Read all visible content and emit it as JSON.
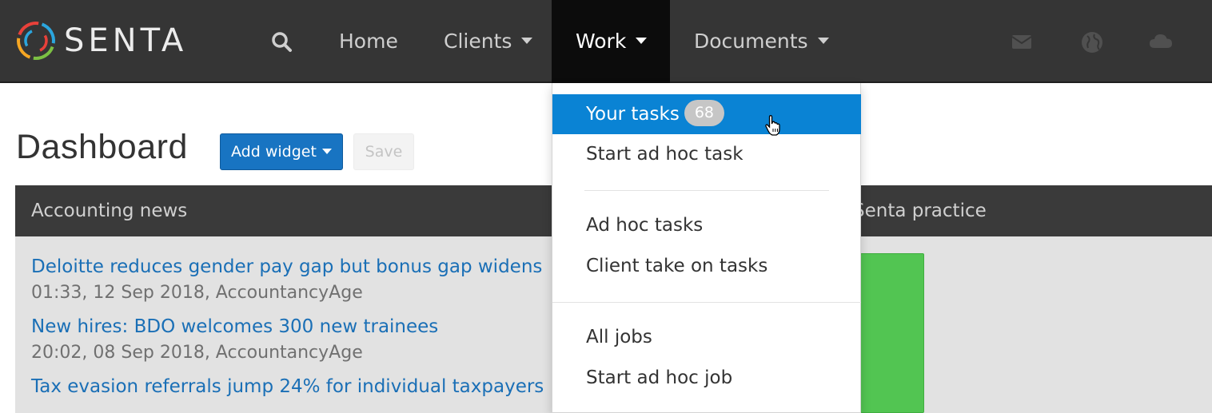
{
  "app": {
    "brand": "SENTA"
  },
  "nav": {
    "home": "Home",
    "clients": "Clients",
    "work": "Work",
    "documents": "Documents"
  },
  "icons": {
    "search": "search-icon",
    "mail": "envelope-icon",
    "globe": "globe-icon",
    "cloud": "cloud-icon"
  },
  "colors": {
    "nav_bg": "#353535",
    "active_nav_bg": "#0c0c0c",
    "accent": "#0a83d4",
    "button_primary": "#1874c2",
    "link": "#1a6fb6",
    "chart_bar": "#52c552"
  },
  "page": {
    "title": "Dashboard",
    "add_widget_label": "Add widget",
    "save_label": "Save"
  },
  "widgets": {
    "news_title": "Accounting news",
    "second_title": "Senta practice",
    "news": [
      {
        "title": "Deloitte reduces gender pay gap but bonus gap widens",
        "meta": "01:33, 12 Sep 2018, AccountancyAge"
      },
      {
        "title": "New hires: BDO welcomes 300 new trainees",
        "meta": "20:02, 08 Sep 2018, AccountancyAge"
      },
      {
        "title": "Tax evasion referrals jump 24% for individual taxpayers",
        "meta": ""
      }
    ]
  },
  "work_menu": {
    "your_tasks": "Your tasks",
    "your_tasks_count": "68",
    "start_ad_hoc_task": "Start ad hoc task",
    "ad_hoc_tasks": "Ad hoc tasks",
    "client_take_on_tasks": "Client take on tasks",
    "all_jobs": "All jobs",
    "start_ad_hoc_job": "Start ad hoc job"
  }
}
